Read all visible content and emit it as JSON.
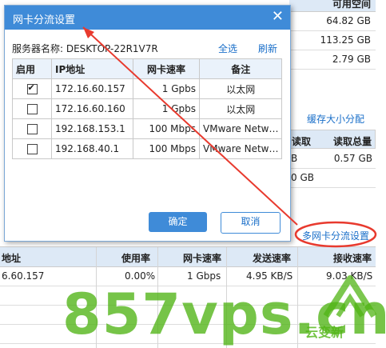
{
  "background": {
    "top_right": {
      "header": "可用空间",
      "values": [
        "64.82 GB",
        "113.25 GB",
        "2.79 GB"
      ]
    },
    "cache_link": "缓存大小分配",
    "right_mid_table": {
      "headers": [
        "读取",
        "读取总量"
      ],
      "rows": [
        [
          "B",
          "0.57 GB"
        ],
        [
          "",
          "0.00 GB"
        ],
        [
          "",
          ""
        ]
      ],
      "col_partial": "0 GB"
    },
    "multi_nic_link": "多网卡分流设置",
    "bottom_table": {
      "headers": [
        "地址",
        "使用率",
        "网卡速率",
        "发送速率",
        "接收速率"
      ],
      "row": [
        "6.60.157",
        "0.00%",
        "1 Gbps",
        "4.95 KB/S",
        "9.03 KB/S"
      ]
    }
  },
  "dialog": {
    "title": "网卡分流设置",
    "server_label": "服务器名称: DESKTOP-22R1V7R",
    "select_all": "全选",
    "refresh": "刷新",
    "columns": [
      "启用",
      "IP地址",
      "网卡速率",
      "备注"
    ],
    "rows": [
      {
        "enabled": true,
        "ip": "172.16.60.157",
        "speed": "1 Gpbs",
        "note": "以太网"
      },
      {
        "enabled": false,
        "ip": "172.16.60.160",
        "speed": "1 Gpbs",
        "note": "以太网"
      },
      {
        "enabled": false,
        "ip": "192.168.153.1",
        "speed": "100 Mbps",
        "note": "VMware Netw…"
      },
      {
        "enabled": false,
        "ip": "192.168.40.1",
        "speed": "100 Mbps",
        "note": "VMware Netw…"
      }
    ],
    "ok_label": "确定",
    "cancel_label": "取消"
  },
  "watermark": "857vps.cn",
  "watermark_sub": "云变新",
  "colors": {
    "accent": "#3f8bd8",
    "annotation_red": "#e83a2e",
    "watermark_green": "#50b414"
  }
}
